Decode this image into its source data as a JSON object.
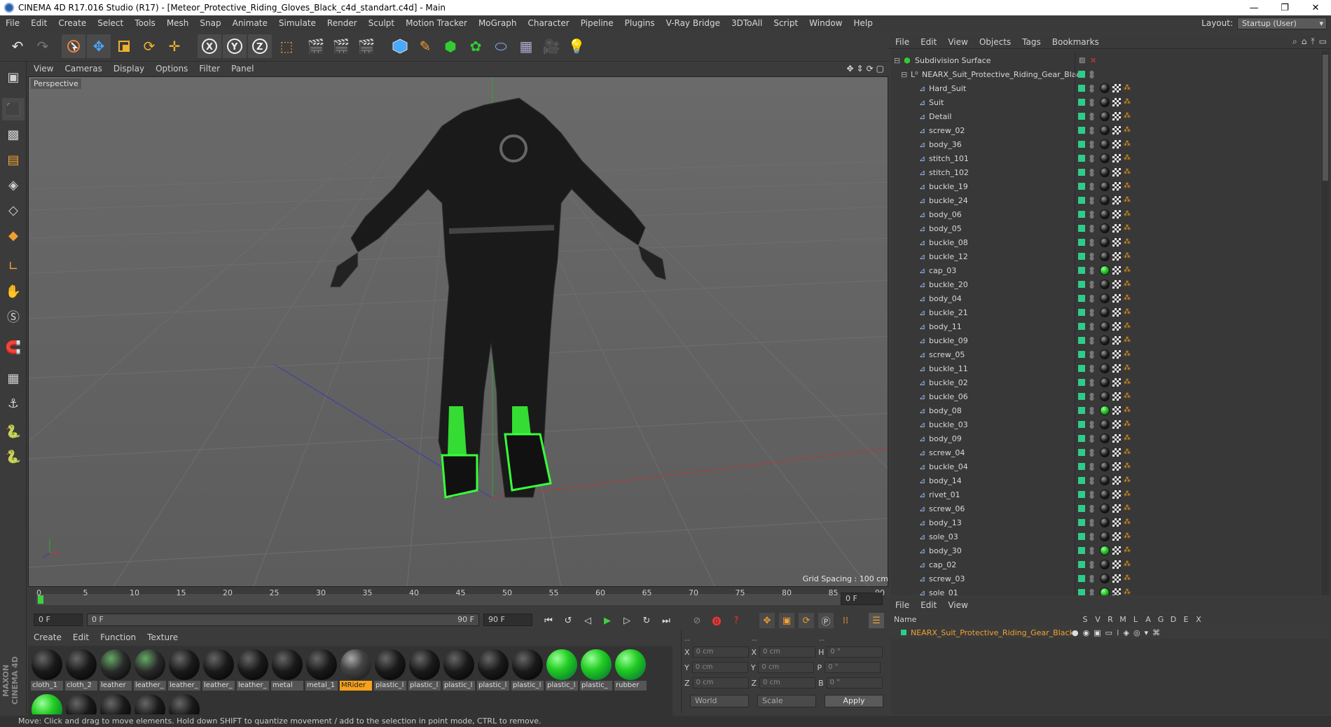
{
  "window": {
    "title": "CINEMA 4D R17.016 Studio (R17) - [Meteor_Protective_Riding_Gloves_Black_c4d_standart.c4d] - Main",
    "controls": [
      "—",
      "❐",
      "✕"
    ]
  },
  "menubar": {
    "items": [
      "File",
      "Edit",
      "Create",
      "Select",
      "Tools",
      "Mesh",
      "Snap",
      "Animate",
      "Simulate",
      "Render",
      "Sculpt",
      "Motion Tracker",
      "MoGraph",
      "Character",
      "Pipeline",
      "Plugins",
      "V-Ray Bridge",
      "3DToAll",
      "Script",
      "Window",
      "Help"
    ],
    "layout_label": "Layout:",
    "layout_value": "Startup (User)"
  },
  "viewport": {
    "menu": [
      "View",
      "Cameras",
      "Display",
      "Options",
      "Filter",
      "Panel"
    ],
    "label": "Perspective",
    "grid_spacing": "Grid Spacing : 100 cm"
  },
  "timeline": {
    "ticks": [
      "0",
      "5",
      "10",
      "15",
      "20",
      "25",
      "30",
      "35",
      "40",
      "45",
      "50",
      "55",
      "60",
      "65",
      "70",
      "75",
      "80",
      "85",
      "90"
    ],
    "current_frame": "0 F",
    "start_frame": "0 F",
    "range_start": "0 F",
    "range_end": "90 F",
    "end_frame": "90 F"
  },
  "material_manager": {
    "menu": [
      "Create",
      "Edit",
      "Function",
      "Texture"
    ],
    "materials": [
      {
        "label": "cloth_1",
        "kind": "black"
      },
      {
        "label": "cloth_2",
        "kind": "black"
      },
      {
        "label": "leather",
        "kind": "leather"
      },
      {
        "label": "leather_",
        "kind": "leather"
      },
      {
        "label": "leather_",
        "kind": "black"
      },
      {
        "label": "leather_",
        "kind": "black"
      },
      {
        "label": "leather_",
        "kind": "black"
      },
      {
        "label": "metal",
        "kind": "black"
      },
      {
        "label": "metal_1",
        "kind": "black"
      },
      {
        "label": "MRider",
        "kind": "mrider",
        "selected": true
      },
      {
        "label": "plastic_l",
        "kind": "black"
      },
      {
        "label": "plastic_l",
        "kind": "black"
      },
      {
        "label": "plastic_l",
        "kind": "black"
      },
      {
        "label": "plastic_l",
        "kind": "black"
      },
      {
        "label": "plastic_l",
        "kind": "black"
      },
      {
        "label": "plastic_l",
        "kind": "green"
      },
      {
        "label": "plastic_",
        "kind": "green"
      },
      {
        "label": "rubber",
        "kind": "green"
      }
    ],
    "second_row": [
      {
        "kind": "green"
      },
      {
        "kind": "black"
      },
      {
        "kind": "black"
      },
      {
        "kind": "black"
      },
      {
        "kind": "black"
      }
    ]
  },
  "coordinates": {
    "header": [
      "--",
      "--",
      "--"
    ],
    "rows": [
      {
        "a": "X",
        "av": "0 cm",
        "b": "X",
        "bv": "0 cm",
        "c": "H",
        "cv": "0 °"
      },
      {
        "a": "Y",
        "av": "0 cm",
        "b": "Y",
        "bv": "0 cm",
        "c": "P",
        "cv": "0 °"
      },
      {
        "a": "Z",
        "av": "0 cm",
        "b": "Z",
        "bv": "0 cm",
        "c": "B",
        "cv": "0 °"
      }
    ],
    "mode": "World",
    "size_mode": "Scale",
    "apply": "Apply"
  },
  "status": "Move: Click and drag to move elements. Hold down SHIFT to quantize movement / add to the selection in point mode, CTRL to remove.",
  "object_manager": {
    "menu": [
      "File",
      "Edit",
      "View",
      "Objects",
      "Tags",
      "Bookmarks"
    ],
    "root": "Subdivision Surface",
    "group": "NEARX_Suit_Protective_Riding_Gear_Black",
    "objects": [
      {
        "name": "Hard_Suit",
        "tag": "black"
      },
      {
        "name": "Suit",
        "tag": "black"
      },
      {
        "name": "Detail",
        "tag": "black"
      },
      {
        "name": "screw_02",
        "tag": "black"
      },
      {
        "name": "body_36",
        "tag": "black"
      },
      {
        "name": "stitch_101",
        "tag": "black"
      },
      {
        "name": "stitch_102",
        "tag": "black"
      },
      {
        "name": "buckle_19",
        "tag": "black"
      },
      {
        "name": "buckle_24",
        "tag": "black"
      },
      {
        "name": "body_06",
        "tag": "black"
      },
      {
        "name": "body_05",
        "tag": "black"
      },
      {
        "name": "buckle_08",
        "tag": "black"
      },
      {
        "name": "buckle_12",
        "tag": "black"
      },
      {
        "name": "cap_03",
        "tag": "green"
      },
      {
        "name": "buckle_20",
        "tag": "black"
      },
      {
        "name": "body_04",
        "tag": "black"
      },
      {
        "name": "buckle_21",
        "tag": "black"
      },
      {
        "name": "body_11",
        "tag": "black"
      },
      {
        "name": "buckle_09",
        "tag": "black"
      },
      {
        "name": "screw_05",
        "tag": "black"
      },
      {
        "name": "buckle_11",
        "tag": "black"
      },
      {
        "name": "buckle_02",
        "tag": "black"
      },
      {
        "name": "buckle_06",
        "tag": "black"
      },
      {
        "name": "body_08",
        "tag": "green"
      },
      {
        "name": "buckle_03",
        "tag": "black"
      },
      {
        "name": "body_09",
        "tag": "black"
      },
      {
        "name": "screw_04",
        "tag": "black"
      },
      {
        "name": "buckle_04",
        "tag": "black"
      },
      {
        "name": "body_14",
        "tag": "black"
      },
      {
        "name": "rivet_01",
        "tag": "black"
      },
      {
        "name": "screw_06",
        "tag": "black"
      },
      {
        "name": "body_13",
        "tag": "black"
      },
      {
        "name": "sole_03",
        "tag": "black"
      },
      {
        "name": "body_30",
        "tag": "green"
      },
      {
        "name": "cap_02",
        "tag": "black"
      },
      {
        "name": "screw_03",
        "tag": "black"
      },
      {
        "name": "sole_01",
        "tag": "green"
      }
    ]
  },
  "layer_manager": {
    "menu": [
      "File",
      "Edit",
      "View"
    ],
    "columns": [
      "Name",
      "S",
      "V",
      "R",
      "M",
      "L",
      "A",
      "G",
      "D",
      "E",
      "X"
    ],
    "layer": "NEARX_Suit_Protective_Riding_Gear_Black"
  },
  "colors": {
    "accent": "#f6a21a",
    "layer_green": "#2ecc8a",
    "viewport_bg": "#5e5e5e",
    "suit_highlight": "#39ff3a"
  }
}
